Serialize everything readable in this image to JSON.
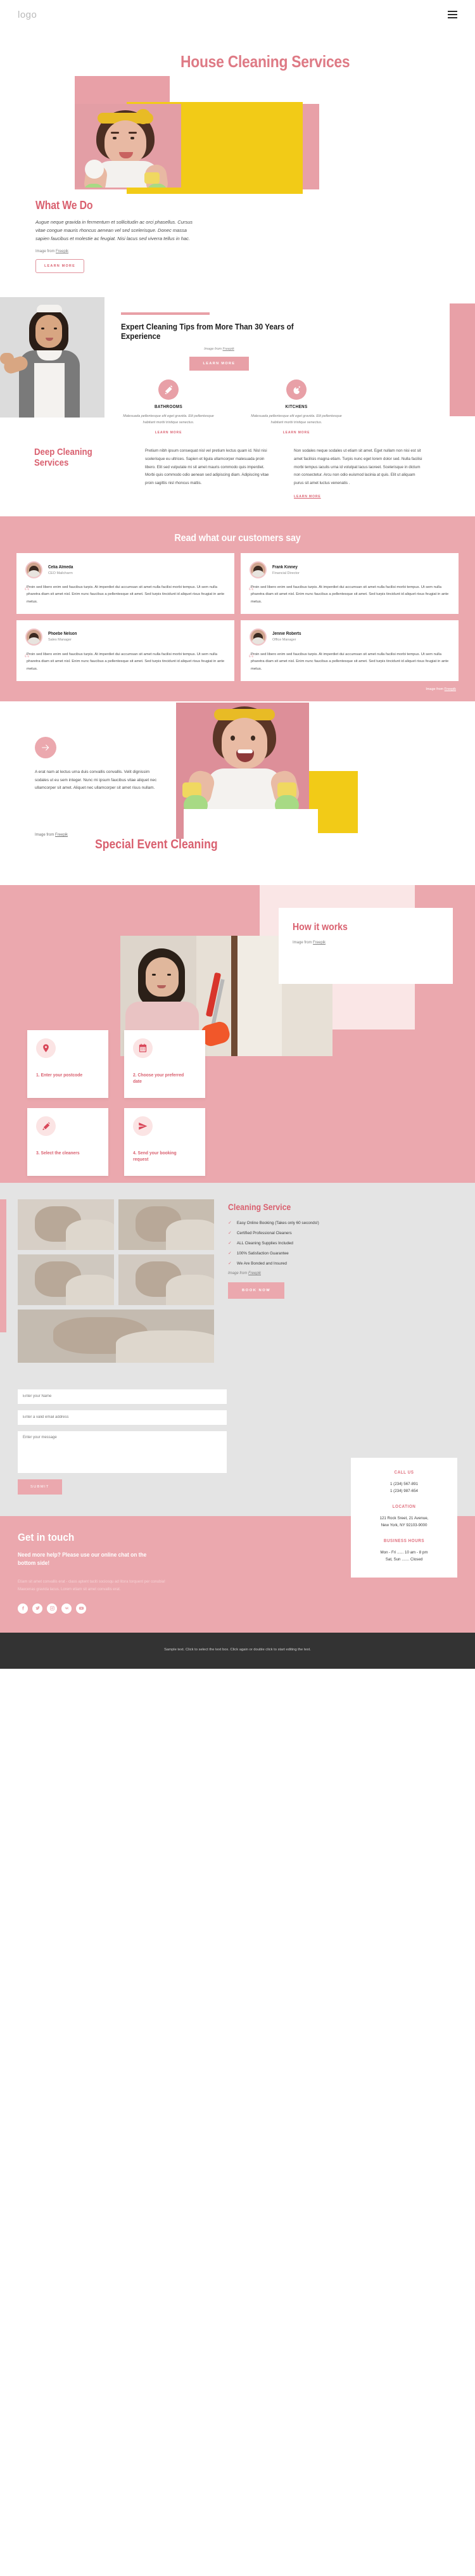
{
  "header": {
    "logo": "logo",
    "menu_icon": "hamburger-menu-icon"
  },
  "hero": {
    "title": "House Cleaning Services"
  },
  "what_we_do": {
    "title": "What We Do",
    "body": "Augue neque gravida in fermentum et sollicitudin ac orci phasellus. Cursus vitae congue mauris rhoncus aenean vel sed scelerisque. Donec massa sapien faucibus et molestie ac feugiat. Nisi lacus sed viverra tellus in hac.",
    "credit_prefix": "Image from ",
    "credit_link": "Freepik",
    "button": "LEARN MORE"
  },
  "tips": {
    "heading": "Expert Cleaning Tips from More Than 30 Years of Experience",
    "credit_prefix": "Image from ",
    "credit_link": "Freepik",
    "button": "LEARN MORE",
    "columns": [
      {
        "icon": "broom-icon",
        "title": "BATHROOMS",
        "body": "Malesuada pellentesque elit eget gravida. Elit pellentesque habitant morbi tristique senectus.",
        "link": "LEARN MORE"
      },
      {
        "icon": "hand-sparkle-icon",
        "title": "KITCHENS",
        "body": "Malesuada pellentesque elit eget gravida. Elit pellentesque habitant morbi tristique senectus.",
        "link": "LEARN MORE"
      }
    ]
  },
  "deep": {
    "title": "Deep Cleaning Services",
    "col1": "Pretium nibh ipsum consequat nisl vel pretium lectus quam id. Nisl nisi scelerisque eu ultrices. Sapien et ligula ullamcorper malesuada proin libero. Elit sed vulputate mi sit amet mauris commodo quis imperdiet. Morbi quis commodo odio aenean sed adipiscing diam. Adipiscing vitae proin sagittis nisl rhoncus mattis.",
    "col2": "Non sodales neque sodales ut etiam sit amet. Eget nullam non nisi est sit amet facilisis magna etiam. Turpis nunc eget lorem dolor sed. Nulla facilisi morbi tempus iaculis urna id volutpat lacus laoreet. Scelerisque in dictum non consectetur. Arcu non odio euismod lacinia at quis. Elit ut aliquam purus sit amet luctus venenatis .",
    "link": "LEARN MORE"
  },
  "testimonials": {
    "heading": "Read what our customers say",
    "quote_mark": "“",
    "credit_prefix": "Image from ",
    "credit_link": "Freepik",
    "items": [
      {
        "name": "Celia Almeda",
        "role": "CEO Mailcharm",
        "text": "Proin sed libero enim sed faucibus turpis. At imperdiet dui accumsan sit amet nulla facilisi morbi tempus. Ut sem nulla pharetra diam sit amet nisl. Enim nunc faucibus a pellentesque sit amet. Sed turpis tincidunt id aliquet risus feugiat in ante metus."
      },
      {
        "name": "Frank Kinney",
        "role": "Financial Director",
        "text": "Proin sed libero enim sed faucibus turpis. At imperdiet dui accumsan sit amet nulla facilisi morbi tempus. Ut sem nulla pharetra diam sit amet nisl. Enim nunc faucibus a pellentesque sit amet. Sed turpis tincidunt id aliquet risus feugiat in ante metus."
      },
      {
        "name": "Phoebe Nelson",
        "role": "Sales Manager",
        "text": "Proin sed libero enim sed faucibus turpis. At imperdiet dui accumsan sit amet nulla facilisi morbi tempus. Ut sem nulla pharetra diam sit amet nisl. Enim nunc faucibus a pellentesque sit amet. Sed turpis tincidunt id aliquet risus feugiat in ante metus."
      },
      {
        "name": "Jennie Roberts",
        "role": "Office Manager",
        "text": "Proin sed libero enim sed faucibus turpis. At imperdiet dui accumsan sit amet nulla facilisi morbi tempus. Ut sem nulla pharetra diam sit amet nisl. Enim nunc faucibus a pellentesque sit amet. Sed turpis tincidunt id aliquet risus feugiat in ante metus."
      }
    ]
  },
  "special": {
    "arrow_icon": "arrow-right-icon",
    "body": "A erat nam at lectus urna duis convallis convallis. Velit dignissim sodales ut eu sem integer. Nunc mi ipsum faucibus vitae aliquet nec ullamcorper sit amet. Aliquet nec ullamcorper sit amet risus nullam.",
    "credit_prefix": "Image from ",
    "credit_link": "Freepik",
    "title": "Special Event Cleaning"
  },
  "how_it_works": {
    "title": "How it works",
    "credit_prefix": "Image from ",
    "credit_link": "Freepik",
    "steps": [
      {
        "icon": "location-pin-icon",
        "label": "1. Enter your postcode"
      },
      {
        "icon": "calendar-icon",
        "label": "2. Choose your preferred date"
      },
      {
        "icon": "broom-icon",
        "label": "3. Select the cleaners"
      },
      {
        "icon": "paper-plane-icon",
        "label": "4. Send your booking request"
      }
    ]
  },
  "cleaning_service": {
    "title": "Cleaning Service",
    "features": [
      "Easy Online Booking (Takes only 60 seconds!)",
      "Certified Professional Cleaners",
      "ALL Cleaning Supplies Included",
      "100% Satisfaction Guarantee",
      "We Are Bonded and Insured"
    ],
    "check_icon": "check-icon",
    "credit_prefix": "Image from ",
    "credit_link": "Freepik",
    "button": "BOOK NOW"
  },
  "contact_form": {
    "name_placeholder": "Enter your Name",
    "email_placeholder": "Enter a valid email address",
    "message_placeholder": "Enter your message",
    "submit": "SUBMIT"
  },
  "get_in_touch": {
    "title": "Get in touch",
    "subtitle": "Need more help? Please use our online chat on the bottom side!",
    "body": "Etiam sit amet convallis erat - class aptent taciti sociosqu ad litora torquent per conubia! Maecenas gravida lacus. Lorem etiam sit amet convallis erat.",
    "socials": [
      {
        "icon": "facebook-icon"
      },
      {
        "icon": "twitter-icon"
      },
      {
        "icon": "instagram-icon"
      },
      {
        "icon": "vk-icon"
      },
      {
        "icon": "youtube-icon"
      }
    ]
  },
  "info_card": {
    "call_us_label": "CALL US",
    "phone1": "1 (234) 567-891",
    "phone2": "1 (234) 987-654",
    "location_label": "LOCATION",
    "address1": "121 Rock Sreet, 21 Avenue,",
    "address2": "New York, NY 92103-9000",
    "hours_label": "BUSINESS HOURS",
    "hours1": "Mon - Fri ...... 10 am - 8 pm",
    "hours2": "Sat, Sun ....... Closed"
  },
  "footer": {
    "text": "Sample text. Click to select the text box. Click again or double click to start editing the text."
  },
  "colors": {
    "pink": "#eba8ae",
    "pink_dark": "#d9606f",
    "yellow": "#f2cb17",
    "grey_bg": "#e4e4e4",
    "footer_bg": "#333333"
  }
}
